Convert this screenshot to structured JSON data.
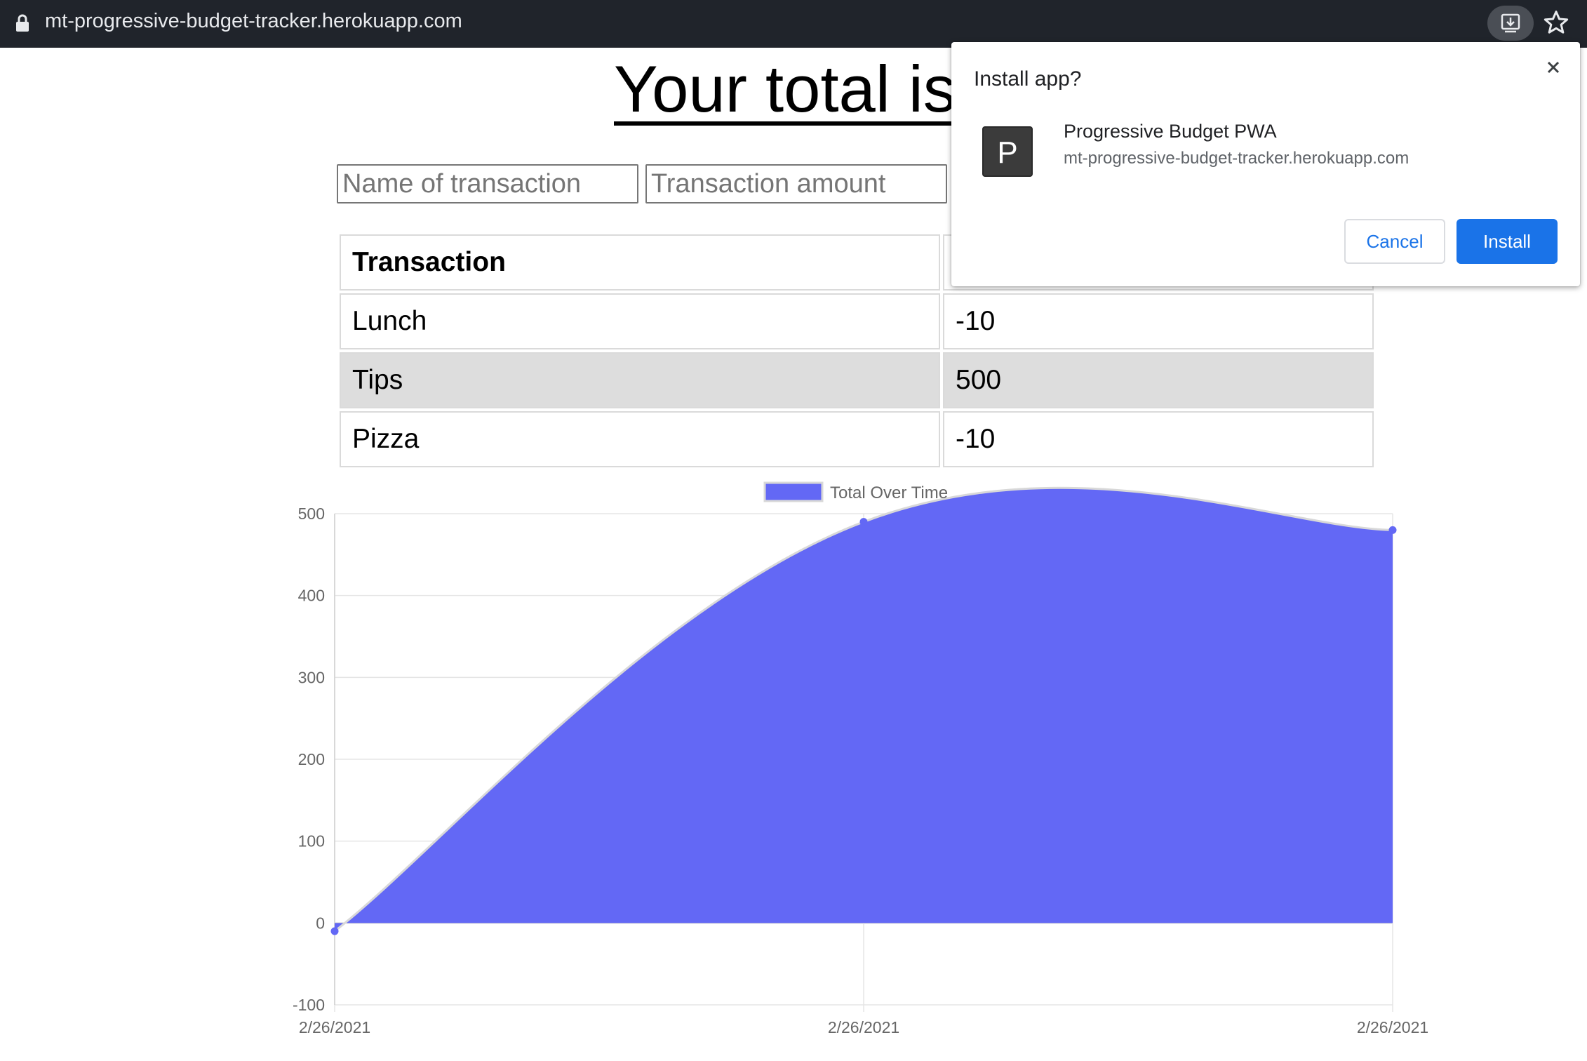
{
  "browser": {
    "url": "mt-progressive-budget-tracker.herokuapp.com",
    "icons": [
      "lock-icon",
      "install-app-icon",
      "bookmark-star-icon"
    ]
  },
  "page": {
    "title": "Your total is:",
    "name_placeholder": "Name of transaction",
    "amount_placeholder": "Transaction amount",
    "table": {
      "header": [
        "Transaction",
        ""
      ],
      "rows": [
        {
          "name": "Lunch",
          "amount": "-10"
        },
        {
          "name": "Tips",
          "amount": "500"
        },
        {
          "name": "Pizza",
          "amount": "-10"
        }
      ]
    }
  },
  "dialog": {
    "title": "Install app?",
    "app_icon_letter": "P",
    "app_name": "Progressive Budget PWA",
    "app_origin": "mt-progressive-budget-tracker.herokuapp.com",
    "cancel_label": "Cancel",
    "install_label": "Install"
  },
  "colors": {
    "browser_bar": "#20242b",
    "area_fill": "#6368f5",
    "accent": "#1a73e8"
  },
  "chart_data": {
    "type": "area",
    "title": "",
    "xlabel": "",
    "ylabel": "",
    "x": [
      "2/26/2021",
      "2/26/2021",
      "2/26/2021"
    ],
    "series": [
      {
        "name": "Total Over Time",
        "values": [
          -10,
          490,
          480
        ]
      }
    ],
    "ylim": [
      -100,
      500
    ],
    "yticks": [
      500,
      400,
      300,
      200,
      100,
      0,
      -100
    ],
    "grid": true,
    "legend": "top-center"
  }
}
